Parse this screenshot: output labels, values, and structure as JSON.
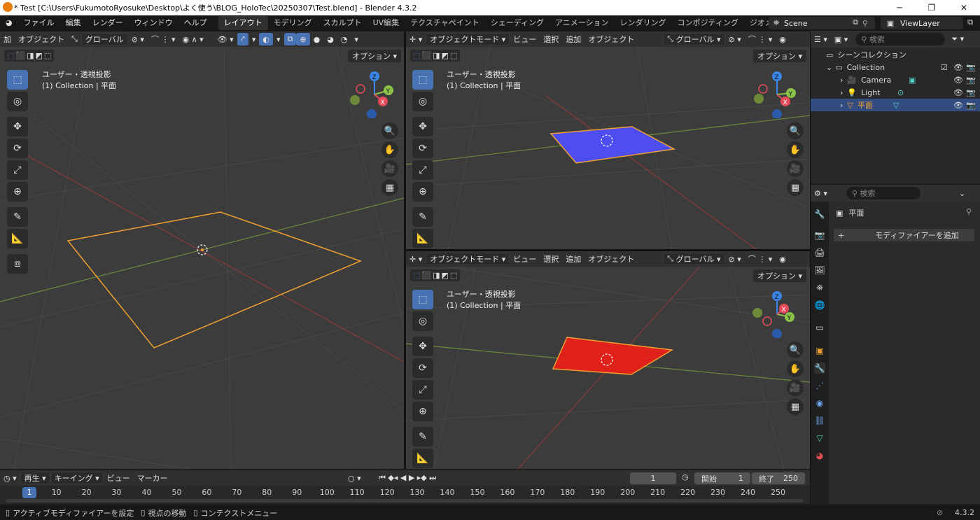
{
  "window": {
    "title": "* Test [C:\\Users\\FukumotoRyosuke\\Desktop\\よく使う\\BLOG_HoloTec\\20250307\\Test.blend] - Blender 4.3.2",
    "minimize": "─",
    "maximize": "❐",
    "close": "✕"
  },
  "menu": {
    "items": [
      "ファイル",
      "編集",
      "レンダー",
      "ウィンドウ",
      "ヘルプ"
    ],
    "workspaces": [
      "レイアウト",
      "モデリング",
      "スカルプト",
      "UV編集",
      "テクスチャペイント",
      "シェーディング",
      "アニメーション",
      "レンダリング",
      "コンポジティング",
      "ジオメトリ:"
    ],
    "active_workspace": "レイアウト",
    "scene": "Scene",
    "view_layer": "ViewLayer"
  },
  "left_viewport": {
    "header_cut": "加",
    "header_object": "オブジェクト",
    "transform": "グローバル",
    "options": "オプション",
    "view_name": "ユーザー・透視投影",
    "collection_line": "(1) Collection | 平面"
  },
  "top_right_viewport": {
    "mode": "オブジェクトモード",
    "menus": [
      "ビュー",
      "選択",
      "追加",
      "オブジェクト"
    ],
    "transform": "グローバル",
    "options": "オプション",
    "view_name": "ユーザー・透視投影",
    "collection_line": "(1) Collection | 平面",
    "plane_color": "#4e4ef0"
  },
  "bottom_right_viewport": {
    "mode": "オブジェクトモード",
    "menus": [
      "ビュー",
      "選択",
      "追加",
      "オブジェクト"
    ],
    "transform": "グローバル",
    "options": "オプション",
    "view_name": "ユーザー・透視投影",
    "collection_line": "(1) Collection | 平面",
    "plane_color": "#e0201a"
  },
  "gizmo": {
    "z": "Z",
    "y": "Y",
    "x": "X"
  },
  "outliner": {
    "search_placeholder": "検索",
    "scene_collection": "シーンコレクション",
    "collection": "Collection",
    "items": [
      "Camera",
      "Light",
      "平面"
    ]
  },
  "properties": {
    "search_placeholder": "検索",
    "object_name": "平面",
    "add_modifier": "モディファイアーを追加"
  },
  "timeline": {
    "menus": [
      "再生",
      "キーイング",
      "ビュー",
      "マーカー"
    ],
    "current_frame": "1",
    "start_label": "開始",
    "start": "1",
    "end_label": "終了",
    "end": "250",
    "ticks": [
      "1",
      "10",
      "20",
      "30",
      "40",
      "50",
      "60",
      "70",
      "80",
      "90",
      "100",
      "110",
      "120",
      "130",
      "140",
      "150",
      "160",
      "170",
      "180",
      "190",
      "200",
      "210",
      "220",
      "230",
      "240",
      "250"
    ]
  },
  "status": {
    "items": [
      "アクティブモディファイアーを設定",
      "視点の移動",
      "コンテクストメニュー"
    ],
    "version": "4.3.2"
  },
  "colors": {
    "accent": "#4772b3",
    "selection_outline": "#f0a030",
    "x_axis": "#e44a5a",
    "y_axis": "#8bc34a",
    "z_axis": "#3b86e8"
  }
}
